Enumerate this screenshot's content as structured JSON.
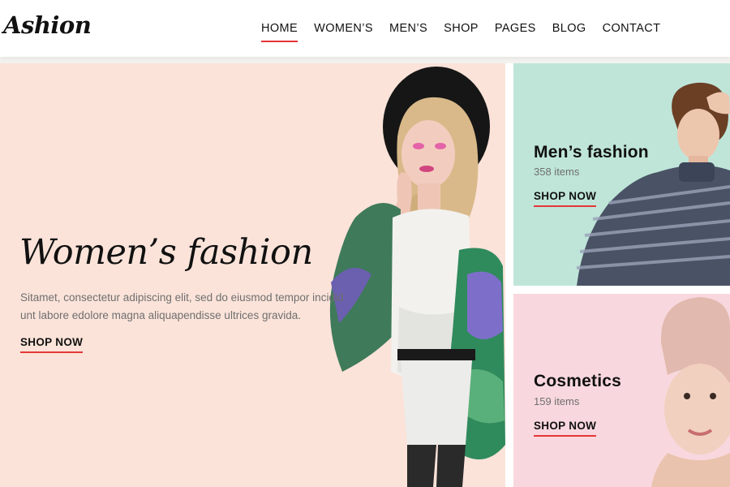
{
  "header": {
    "logo": "Ashion",
    "nav": [
      "HOME",
      "WOMEN’S",
      "MEN’S",
      "SHOP",
      "PAGES",
      "BLOG",
      "CONTACT"
    ],
    "active_nav": "HOME"
  },
  "hero": {
    "title": "Women’s fashion",
    "description": "Sitamet, consectetur adipiscing elit, sed do eiusmod tempor incidid unt labore edolore magna aliquapendisse ultrices gravida.",
    "cta": "SHOP NOW",
    "background": "#fbe3d9"
  },
  "side_panels": {
    "men": {
      "title": "Men’s fashion",
      "count": "358 items",
      "cta": "SHOP NOW",
      "background": "#bfe5d9"
    },
    "cosmetics": {
      "title": "Cosmetics",
      "count": "159 items",
      "cta": "SHOP NOW",
      "background": "#f8d8de"
    }
  },
  "colors": {
    "accent": "#e53637",
    "text": "#111111",
    "muted": "#6f6f6f"
  }
}
